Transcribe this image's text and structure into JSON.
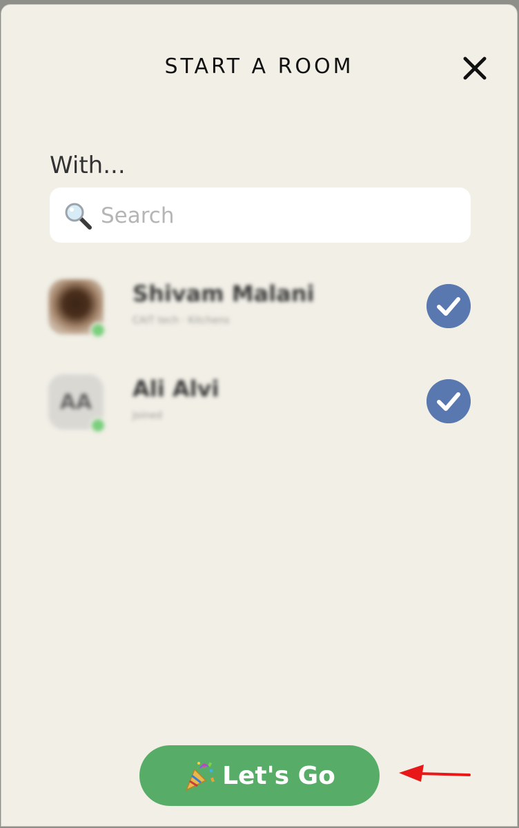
{
  "header": {
    "title": "START A ROOM"
  },
  "with_label": "With...",
  "search": {
    "placeholder": "Search"
  },
  "people": [
    {
      "name": "Shivam Malani",
      "subtitle": "CAIT tech · Kitchens",
      "avatar_type": "photo",
      "selected": true
    },
    {
      "name": "Ali Alvi",
      "subtitle": "Joined",
      "avatar_initials": "AA",
      "avatar_type": "initials",
      "selected": true
    }
  ],
  "action": {
    "label": "Let's Go",
    "icon": "party-popper-icon"
  },
  "annotation": {
    "icon": "red-arrow-icon"
  },
  "colors": {
    "background": "#f1efe6",
    "check_fill": "#5a78b0",
    "button_fill": "#57ad68",
    "arrow": "#e81818"
  }
}
